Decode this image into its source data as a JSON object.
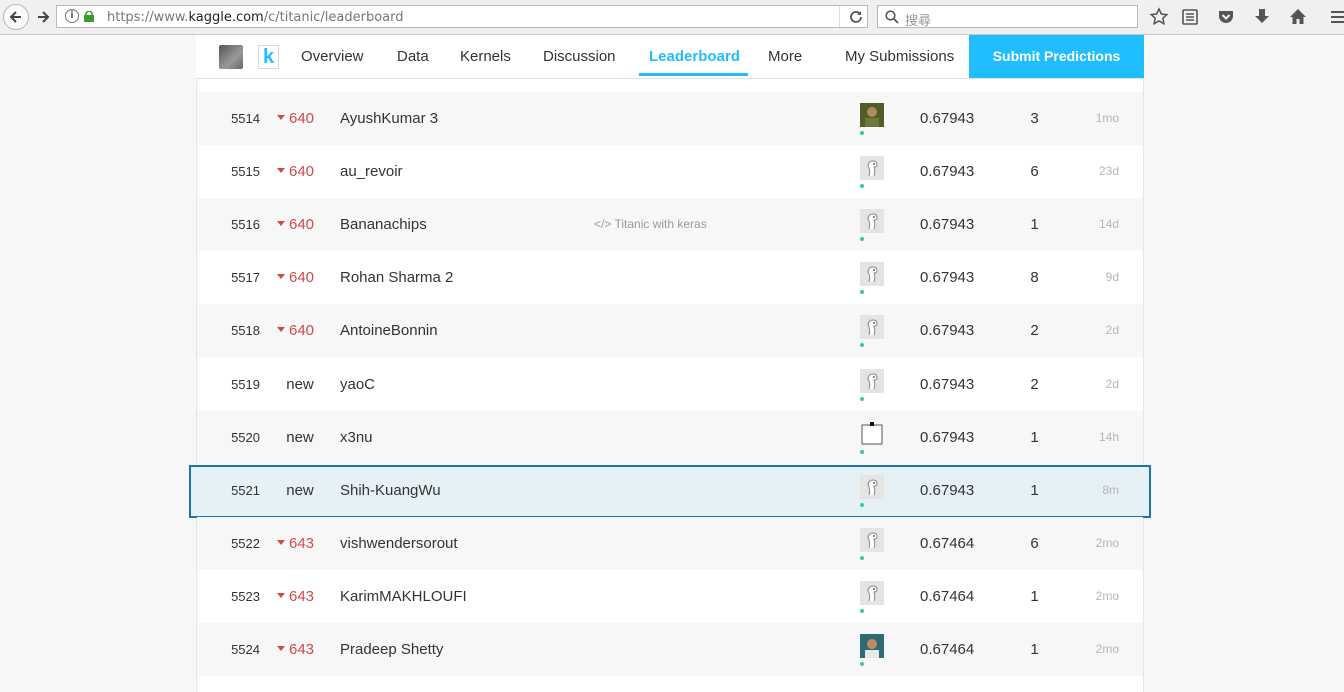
{
  "browser": {
    "url_prefix": "https://www.",
    "url_domain": "kaggle.com",
    "url_path": "/c/titanic/leaderboard",
    "search_placeholder": "搜尋"
  },
  "nav": {
    "tabs": [
      "Overview",
      "Data",
      "Kernels",
      "Discussion",
      "Leaderboard",
      "More"
    ],
    "active_tab": "Leaderboard",
    "my_submissions": "My Submissions",
    "submit_label": "Submit Predictions",
    "accent_color": "#20beff"
  },
  "leaderboard": {
    "rows": [
      {
        "rank": "5514",
        "change": "640",
        "change_type": "down",
        "team": "AyushKumar 3",
        "kernel": "",
        "avatar": "photo-green",
        "score": "0.67943",
        "entries": "3",
        "last": "1mo"
      },
      {
        "rank": "5515",
        "change": "640",
        "change_type": "down",
        "team": "au_revoir",
        "kernel": "",
        "avatar": "default-goose",
        "score": "0.67943",
        "entries": "6",
        "last": "23d"
      },
      {
        "rank": "5516",
        "change": "640",
        "change_type": "down",
        "team": "Bananachips",
        "kernel": "Titanic with keras",
        "avatar": "default-goose",
        "score": "0.67943",
        "entries": "1",
        "last": "14d"
      },
      {
        "rank": "5517",
        "change": "640",
        "change_type": "down",
        "team": "Rohan Sharma 2",
        "kernel": "",
        "avatar": "default-goose",
        "score": "0.67943",
        "entries": "8",
        "last": "9d"
      },
      {
        "rank": "5518",
        "change": "640",
        "change_type": "down",
        "team": "AntoineBonnin",
        "kernel": "",
        "avatar": "default-goose",
        "score": "0.67943",
        "entries": "2",
        "last": "2d"
      },
      {
        "rank": "5519",
        "change": "new",
        "change_type": "new",
        "team": "yaoC",
        "kernel": "",
        "avatar": "default-goose",
        "score": "0.67943",
        "entries": "2",
        "last": "2d"
      },
      {
        "rank": "5520",
        "change": "new",
        "change_type": "new",
        "team": "x3nu",
        "kernel": "",
        "avatar": "blank-square",
        "score": "0.67943",
        "entries": "1",
        "last": "14h"
      },
      {
        "rank": "5521",
        "change": "new",
        "change_type": "new",
        "team": "Shih-KuangWu",
        "kernel": "",
        "avatar": "default-goose",
        "score": "0.67943",
        "entries": "1",
        "last": "8m",
        "highlighted": true
      },
      {
        "rank": "5522",
        "change": "643",
        "change_type": "down",
        "team": "vishwendersorout",
        "kernel": "",
        "avatar": "default-goose",
        "score": "0.67464",
        "entries": "6",
        "last": "2mo"
      },
      {
        "rank": "5523",
        "change": "643",
        "change_type": "down",
        "team": "KarimMAKHLOUFI",
        "kernel": "",
        "avatar": "default-goose",
        "score": "0.67464",
        "entries": "1",
        "last": "2mo"
      },
      {
        "rank": "5524",
        "change": "643",
        "change_type": "down",
        "team": "Pradeep Shetty",
        "kernel": "",
        "avatar": "photo-person",
        "score": "0.67464",
        "entries": "1",
        "last": "2mo"
      }
    ],
    "down_color": "#d04a4a",
    "highlight_border_color": "#1e73a8"
  }
}
